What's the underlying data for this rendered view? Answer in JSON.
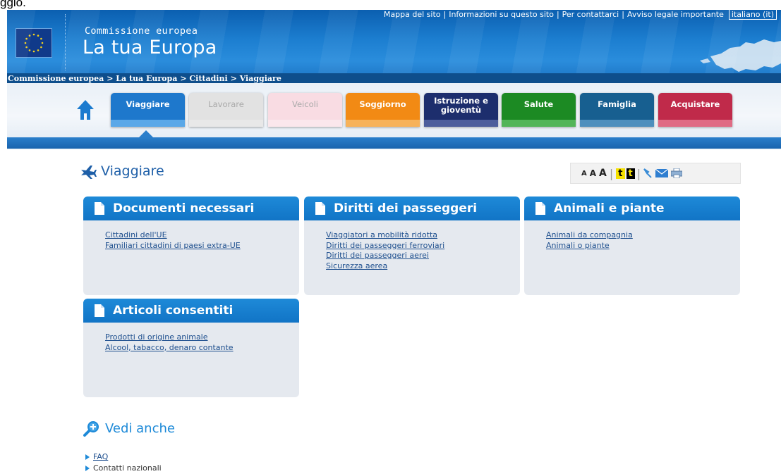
{
  "clipped_text": "ggio.",
  "header": {
    "org": "Commissione europea",
    "site_name": "La tua Europa",
    "top_links": [
      "Mappa del sito",
      "Informazioni su questo sito",
      "Per contattarci",
      "Avviso legale importante"
    ],
    "language": "italiano (it)"
  },
  "breadcrumb": [
    "Commissione europea",
    "> La tua Europa",
    "> Cittadini",
    "> Viaggiare"
  ],
  "tabs": [
    {
      "label": "Viaggiare",
      "color": "#1e78cc",
      "stripe": "#5aa8e8",
      "active": true
    },
    {
      "label": "Lavorare",
      "color": "#e2e2e2",
      "stripe": "#e8e8e8",
      "active": false
    },
    {
      "label": "Veicoli",
      "color": "#f9dce3",
      "stripe": "#fbe7ec",
      "active": false
    },
    {
      "label": "Soggiorno",
      "color": "#f28a14",
      "stripe": "#f7b25a",
      "active": true
    },
    {
      "label": "Istruzione e gioventù",
      "color": "#1d2e6d",
      "stripe": "#4d5e9c",
      "active": true
    },
    {
      "label": "Salute",
      "color": "#1c8a23",
      "stripe": "#52b558",
      "active": true
    },
    {
      "label": "Famiglia",
      "color": "#175f90",
      "stripe": "#4e8fbd",
      "active": true
    },
    {
      "label": "Acquistare",
      "color": "#c02a4a",
      "stripe": "#e06b84",
      "active": true
    }
  ],
  "page_title": "Viaggiare",
  "toolbar": {
    "a1": "A",
    "a2": "A",
    "a3": "A",
    "t1": "t",
    "t2": "t"
  },
  "cards": [
    {
      "title": "Documenti necessari",
      "links": [
        "Cittadini dell'UE",
        "Familiari cittadini di paesi extra-UE"
      ]
    },
    {
      "title": "Diritti dei passeggeri",
      "links": [
        "Viaggiatori a mobilità ridotta",
        "Diritti dei passeggeri ferroviari",
        "Diritti dei passeggeri aerei",
        "Sicurezza aerea"
      ]
    },
    {
      "title": "Animali e piante",
      "links": [
        "Animali da compagnia",
        "Animali o piante"
      ]
    },
    {
      "title": "Articoli consentiti",
      "links": [
        "Prodotti di origine animale",
        "Alcool, tabacco, denaro contante"
      ]
    }
  ],
  "see_also": {
    "title": "Vedi anche",
    "items": [
      "FAQ",
      "Contatti nazionali"
    ]
  }
}
